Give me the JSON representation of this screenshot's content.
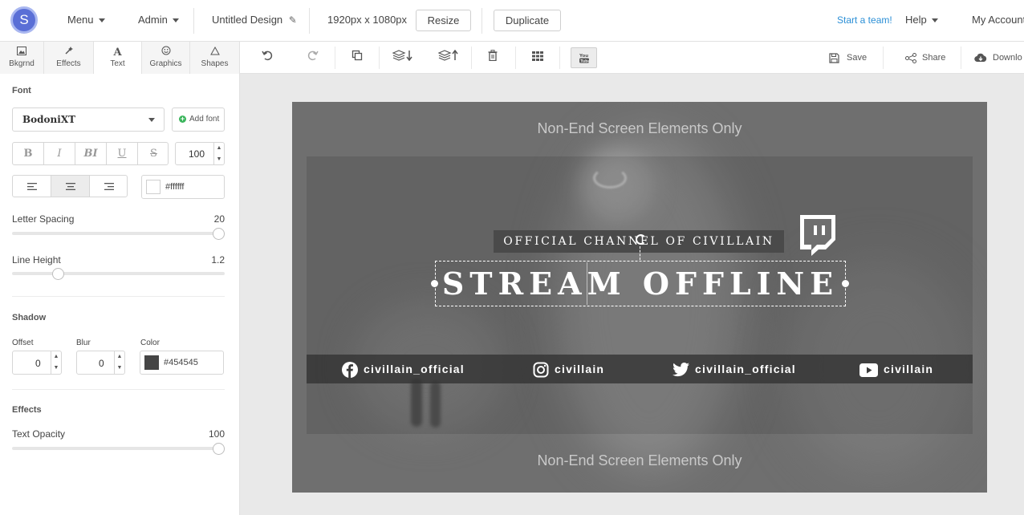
{
  "app": {
    "logo_letter": "S"
  },
  "topbar": {
    "menu_label": "Menu",
    "admin_label": "Admin",
    "design_name": "Untitled Design",
    "dimensions": "1920px x 1080px",
    "resize_label": "Resize",
    "duplicate_label": "Duplicate",
    "team_link": "Start a team!",
    "help_label": "Help",
    "account_label": "My Account"
  },
  "tabs": [
    {
      "label": "Bkgrnd",
      "icon": "image-icon"
    },
    {
      "label": "Effects",
      "icon": "wand-icon"
    },
    {
      "label": "Text",
      "icon": "text-icon"
    },
    {
      "label": "Graphics",
      "icon": "smiley-icon"
    },
    {
      "label": "Shapes",
      "icon": "triangle-icon"
    }
  ],
  "font": {
    "section_label": "Font",
    "family": "BodoniXT",
    "add_font_label": "Add font",
    "size": "100",
    "color_value": "#ffffff",
    "letter_spacing_label": "Letter Spacing",
    "letter_spacing_value": "20",
    "letter_spacing_fraction": 1.0,
    "line_height_label": "Line Height",
    "line_height_value": "1.2",
    "line_height_fraction": 0.2,
    "format_buttons": [
      "B",
      "I",
      "BI",
      "U",
      "S"
    ],
    "align_selected": "center"
  },
  "shadow": {
    "section_label": "Shadow",
    "offset_label": "Offset",
    "offset_value": "0",
    "blur_label": "Blur",
    "blur_value": "0",
    "color_label": "Color",
    "color_value": "#454545",
    "swatch_color": "#454545"
  },
  "effects": {
    "section_label": "Effects",
    "opacity_label": "Text Opacity",
    "opacity_value": "100",
    "opacity_fraction": 1.0
  },
  "toolbar": {
    "save_label": "Save",
    "share_label": "Share",
    "download_label": "Downlo"
  },
  "canvas": {
    "top_note": "Non-End Screen Elements Only",
    "bottom_note": "Non-End Screen Elements Only",
    "channel_line": "OFFICIAL CHANNEL OF CIVILLAIN",
    "title": "STREAM OFFLINE",
    "socials": [
      {
        "icon": "facebook-icon",
        "handle": "civillain_official"
      },
      {
        "icon": "instagram-icon",
        "handle": "civillain"
      },
      {
        "icon": "twitter-icon",
        "handle": "civillain_official"
      },
      {
        "icon": "youtube-icon",
        "handle": "civillain"
      }
    ]
  },
  "colors": {
    "accent": "#2b8fd6",
    "logo": "#5a6fd6",
    "workspace_bg": "#e9e9e9",
    "canvas_bg": "#6f6f6f"
  }
}
